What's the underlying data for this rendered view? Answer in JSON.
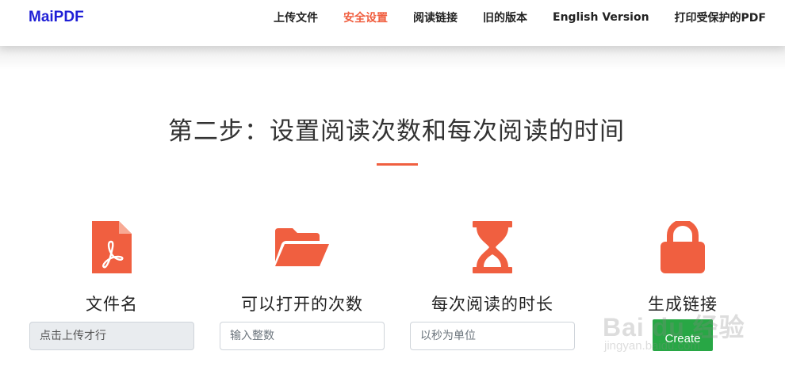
{
  "brand": "MaiPDF",
  "nav": {
    "items": [
      {
        "label": "上传文件"
      },
      {
        "label": "安全设置",
        "active": true
      },
      {
        "label": "阅读链接"
      },
      {
        "label": "旧的版本"
      },
      {
        "label": "English Version"
      },
      {
        "label": "打印受保护的PDF"
      }
    ]
  },
  "section": {
    "title": "第二步：设置阅读次数和每次阅读的时间"
  },
  "steps": [
    {
      "icon": "pdf-file-icon",
      "label": "文件名",
      "field_value": "点击上传才行"
    },
    {
      "icon": "folder-open-icon",
      "label": "可以打开的次数",
      "field_placeholder": "输入整数"
    },
    {
      "icon": "hourglass-icon",
      "label": "每次阅读的时长",
      "field_placeholder": "以秒为单位"
    },
    {
      "icon": "lock-icon",
      "label": "生成链接",
      "button_label": "Create"
    }
  ],
  "watermark": {
    "main": "Bai du 经验",
    "sub": "jingyan.baidu.com"
  },
  "colors": {
    "accent": "#f05f40",
    "brand": "#1f1fd6",
    "button": "#28a745"
  }
}
